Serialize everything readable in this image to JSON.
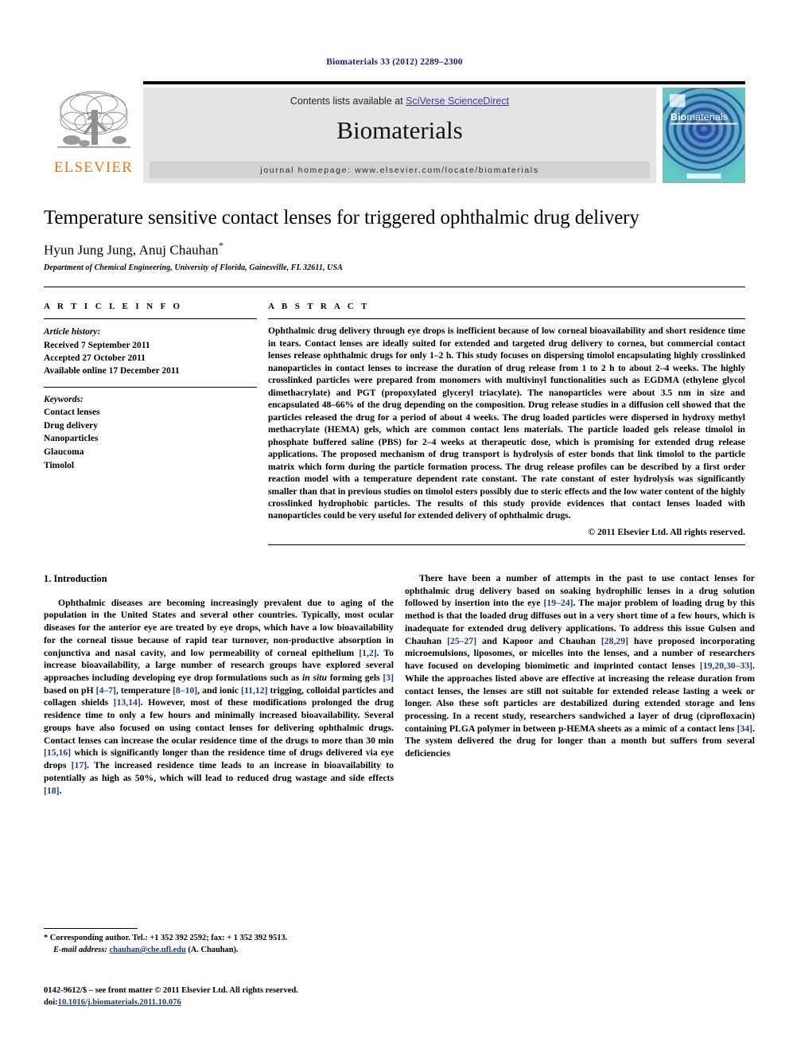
{
  "running_head": "Biomaterials 33 (2012) 2289–2300",
  "header": {
    "contents_prefix": "Contents lists available at ",
    "sciencedirect_link": "SciVerse ScienceDirect",
    "journal_name": "Biomaterials",
    "homepage_text": "journal homepage: www.elsevier.com/locate/biomaterials",
    "elsevier_wordmark": "ELSEVIER",
    "cover_title": "Biomaterials",
    "accent_orange": "#E87722",
    "link_blue": "#3b3b9e",
    "panel_gray": "#e4e4e4"
  },
  "title_block": {
    "title": "Temperature sensitive contact lenses for triggered ophthalmic drug delivery",
    "authors": "Hyun Jung Jung, Anuj Chauhan",
    "corresponding_marker": "*",
    "affiliation": "Department of Chemical Engineering, University of Florida, Gainesville, FL 32611, USA"
  },
  "article_info": {
    "label": "A R T I C L E   I N F O",
    "history_label": "Article history:",
    "history": [
      "Received 7 September 2011",
      "Accepted 27 October 2011",
      "Available online 17 December 2011"
    ],
    "keywords_label": "Keywords:",
    "keywords": [
      "Contact lenses",
      "Drug delivery",
      "Nanoparticles",
      "Glaucoma",
      "Timolol"
    ]
  },
  "abstract": {
    "label": "A B S T R A C T",
    "text": "Ophthalmic drug delivery through eye drops is inefficient because of low corneal bioavailability and short residence time in tears. Contact lenses are ideally suited for extended and targeted drug delivery to cornea, but commercial contact lenses release ophthalmic drugs for only 1–2 h. This study focuses on dispersing timolol encapsulating highly crosslinked nanoparticles in contact lenses to increase the duration of drug release from 1 to 2 h to about 2–4 weeks. The highly crosslinked particles were prepared from monomers with multivinyl functionalities such as EGDMA (ethylene glycol dimethacrylate) and PGT (propoxylated glyceryl triacylate). The nanoparticles were about 3.5 nm in size and encapsulated 48–66% of the drug depending on the composition. Drug release studies in a diffusion cell showed that the particles released the drug for a period of about 4 weeks. The drug loaded particles were dispersed in hydroxy methyl methacrylate (HEMA) gels, which are common contact lens materials. The particle loaded gels release timolol in phosphate buffered saline (PBS) for 2–4 weeks at therapeutic dose, which is promising for extended drug release applications. The proposed mechanism of drug transport is hydrolysis of ester bonds that link timolol to the particle matrix which form during the particle formation process. The drug release profiles can be described by a first order reaction model with a temperature dependent rate constant. The rate constant of ester hydrolysis was significantly smaller than that in previous studies on timolol esters possibly due to steric effects and the low water content of the highly crosslinked hydrophobic particles. The results of this study provide evidences that contact lenses loaded with nanoparticles could be very useful for extended delivery of ophthalmic drugs.",
    "copyright": "© 2011 Elsevier Ltd. All rights reserved."
  },
  "introduction": {
    "heading": "1. Introduction",
    "left_para1_parts": [
      {
        "t": "Ophthalmic diseases are becoming increasingly prevalent due to aging of the population in the United States and several other countries. Typically, most ocular diseases for the anterior eye are treated by eye drops, which have a low bioavailability for the corneal tissue because of rapid tear turnover, non-productive absorption in conjunctiva and nasal cavity, and low permeability of corneal epithelium "
      },
      {
        "t": "[1,2]",
        "k": "ref"
      },
      {
        "t": ". To increase bioavailability, a large number of research groups have explored several approaches including developing eye drop formulations such as "
      },
      {
        "t": "in situ",
        "k": "ital"
      },
      {
        "t": " forming gels "
      },
      {
        "t": "[3]",
        "k": "ref"
      },
      {
        "t": " based on pH "
      },
      {
        "t": "[4–7]",
        "k": "ref"
      },
      {
        "t": ", temperature "
      },
      {
        "t": "[8–10]",
        "k": "ref"
      },
      {
        "t": ", and ionic "
      },
      {
        "t": "[11,12]",
        "k": "ref"
      },
      {
        "t": " trigging, colloidal particles and collagen shields "
      },
      {
        "t": "[13,14]",
        "k": "ref"
      },
      {
        "t": ". However, most of these modifications prolonged the drug residence time to only a few hours and minimally increased bioavailability. Several groups have also focused on using contact lenses for delivering ophthalmic drugs. Contact lenses can increase the ocular residence time of the drugs to more than 30 min "
      },
      {
        "t": "[15,16]",
        "k": "ref"
      },
      {
        "t": " which is significantly longer than the residence time of drugs delivered via eye drops "
      },
      {
        "t": "[17]",
        "k": "ref"
      },
      {
        "t": ". The increased residence time leads to an increase in bioavailability to potentially as high as 50%, which will lead to reduced drug wastage and side effects "
      },
      {
        "t": "[18]",
        "k": "ref"
      },
      {
        "t": "."
      }
    ],
    "para2_parts": [
      {
        "t": "There have been a number of attempts in the past to use contact lenses for ophthalmic drug delivery based on soaking hydrophilic lenses in a drug solution followed by insertion into the eye "
      },
      {
        "t": "[19–24]",
        "k": "ref"
      },
      {
        "t": ". The major problem of loading drug by this method is that the loaded drug diffuses out in a very short time of a few hours, which is inadequate for extended drug delivery applications. To address this issue Gulsen and Chauhan "
      },
      {
        "t": "[25–27]",
        "k": "ref"
      },
      {
        "t": " and Kapoor and Chauhan "
      },
      {
        "t": "[28,29]",
        "k": "ref"
      },
      {
        "t": " have proposed incorporating microemulsions, liposomes, or micelles into the lenses, and a number of researchers have focused on developing biomimetic and imprinted contact lenses "
      },
      {
        "t": "[19,20,30–33]",
        "k": "ref"
      },
      {
        "t": ". While the approaches listed above are effective at increasing the release duration from contact lenses, the lenses are still not suitable for extended release lasting a week or longer. Also these soft particles are destabilized during extended storage and lens processing. In a recent study, researchers sandwiched a layer of drug (ciprofloxacin) containing PLGA polymer in between p-HEMA sheets as a mimic of a contact lens "
      },
      {
        "t": "[34]",
        "k": "ref"
      },
      {
        "t": ". The system delivered the drug for longer than a month but suffers from several deficiencies"
      }
    ]
  },
  "footnotes": {
    "corresponding": "* Corresponding author. Tel.: +1 352 392 2592; fax: + 1 352 392 9513.",
    "email_label": "E-mail address:",
    "email": "chauhan@che.ufl.edu",
    "email_suffix": " (A. Chauhan).",
    "issn_line": "0142-9612/$ – see front matter © 2011 Elsevier Ltd. All rights reserved.",
    "doi_label": "doi:",
    "doi": "10.1016/j.biomaterials.2011.10.076"
  }
}
